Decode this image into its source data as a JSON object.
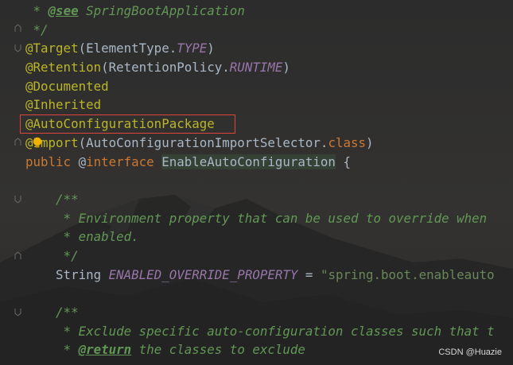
{
  "editor": {
    "lines": [
      {
        "indent": "",
        "parts": [
          {
            "t": " * ",
            "c": "c-doc"
          },
          {
            "t": "@see",
            "c": "c-tag"
          },
          {
            "t": " SpringBootApplication",
            "c": "c-doc"
          }
        ]
      },
      {
        "indent": "",
        "parts": [
          {
            "t": " */",
            "c": "c-doc"
          }
        ]
      },
      {
        "indent": "",
        "parts": [
          {
            "t": "@Target",
            "c": "ann"
          },
          {
            "t": "(ElementType.",
            "c": "plain"
          },
          {
            "t": "TYPE",
            "c": "const"
          },
          {
            "t": ")",
            "c": "plain"
          }
        ]
      },
      {
        "indent": "",
        "parts": [
          {
            "t": "@Retention",
            "c": "ann"
          },
          {
            "t": "(RetentionPolicy.",
            "c": "plain"
          },
          {
            "t": "RUNTIME",
            "c": "const"
          },
          {
            "t": ")",
            "c": "plain"
          }
        ]
      },
      {
        "indent": "",
        "parts": [
          {
            "t": "@Documented",
            "c": "ann"
          }
        ]
      },
      {
        "indent": "",
        "parts": [
          {
            "t": "@Inherited",
            "c": "ann"
          }
        ]
      },
      {
        "indent": "",
        "parts": [
          {
            "t": "@AutoConfigurationPackage",
            "c": "ann"
          }
        ]
      },
      {
        "indent": "",
        "parts": [
          {
            "t": "@Import",
            "c": "ann"
          },
          {
            "t": "(AutoConfigurationImportSelector.",
            "c": "plain"
          },
          {
            "t": "class",
            "c": "kw"
          },
          {
            "t": ")",
            "c": "plain"
          }
        ]
      },
      {
        "indent": "",
        "parts": [
          {
            "t": "public ",
            "c": "kw"
          },
          {
            "t": "@",
            "c": "plain"
          },
          {
            "t": "interface ",
            "c": "kw"
          },
          {
            "t": "EnableAutoConfiguration",
            "c": "cls-hl"
          },
          {
            "t": " {",
            "c": "plain"
          }
        ]
      },
      {
        "indent": "",
        "parts": []
      },
      {
        "indent": "    ",
        "parts": [
          {
            "t": "/**",
            "c": "c-doc"
          }
        ]
      },
      {
        "indent": "    ",
        "parts": [
          {
            "t": " * Environment property that can be used to override when",
            "c": "c-doc"
          }
        ]
      },
      {
        "indent": "    ",
        "parts": [
          {
            "t": " * enabled.",
            "c": "c-doc"
          }
        ]
      },
      {
        "indent": "    ",
        "parts": [
          {
            "t": " */",
            "c": "c-doc"
          }
        ]
      },
      {
        "indent": "    ",
        "parts": [
          {
            "t": "String ",
            "c": "plain"
          },
          {
            "t": "ENABLED_OVERRIDE_PROPERTY",
            "c": "const"
          },
          {
            "t": " = ",
            "c": "plain"
          },
          {
            "t": "\"spring.boot.enableauto",
            "c": "str"
          }
        ]
      },
      {
        "indent": "",
        "parts": []
      },
      {
        "indent": "    ",
        "parts": [
          {
            "t": "/**",
            "c": "c-doc"
          }
        ]
      },
      {
        "indent": "    ",
        "parts": [
          {
            "t": " * Exclude specific auto-configuration classes such that t",
            "c": "c-doc"
          }
        ]
      },
      {
        "indent": "    ",
        "parts": [
          {
            "t": " * ",
            "c": "c-doc"
          },
          {
            "t": "@return",
            "c": "c-tag"
          },
          {
            "t": " the classes to exclude",
            "c": "c-doc"
          }
        ]
      }
    ],
    "highlighted_line_text": "@AutoConfigurationPackage",
    "intention_icon": "lightbulb-icon"
  },
  "watermark": "CSDN @Huazie",
  "colors": {
    "background": "#2b2b2b",
    "annotation": "#bbb529",
    "keyword": "#cc7832",
    "javadoc": "#629755",
    "constant": "#9876aa",
    "string": "#6a8759",
    "highlight_box": "#e0443c"
  }
}
